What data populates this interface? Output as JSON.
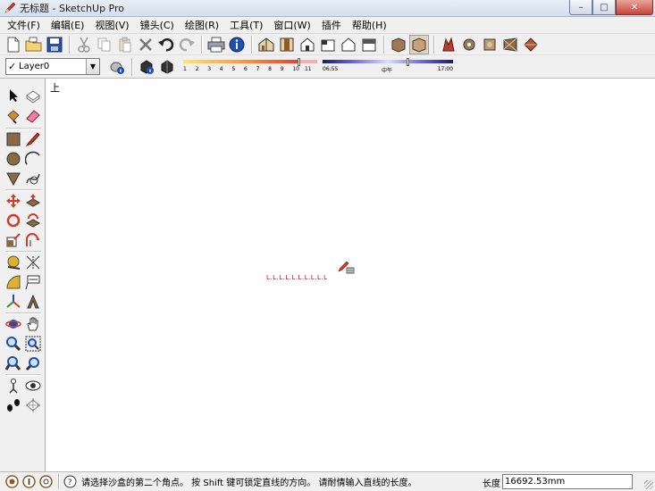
{
  "window": {
    "title": "无标题 - SketchUp Pro",
    "icon": "sketchup-pencil-icon",
    "controls": {
      "minimize": "–",
      "maximize": "□",
      "close": "✕"
    }
  },
  "menu": [
    "文件(F)",
    "编辑(E)",
    "视图(V)",
    "镜头(C)",
    "绘图(R)",
    "工具(T)",
    "窗口(W)",
    "插件",
    "帮助(H)"
  ],
  "toolbar_standard": [
    "new-icon",
    "open-icon",
    "save-icon",
    "cut-icon",
    "copy-icon",
    "paste-icon",
    "erase-icon",
    "undo-icon",
    "redo-icon",
    "print-icon",
    "model-info-icon"
  ],
  "toolbar_views": [
    "iso-view-icon",
    "top-view-icon",
    "front-view-icon",
    "right-view-icon",
    "back-view-icon",
    "left-view-icon"
  ],
  "toolbar_styles": [
    "xray-icon",
    "wireframe-icon",
    "hidden-line-icon",
    "shaded-icon",
    "shaded-texture-icon",
    "monochrome-icon"
  ],
  "layers": {
    "current": "Layer0",
    "checked": "✓"
  },
  "shadows": {
    "months": [
      "1",
      "2",
      "3",
      "4",
      "5",
      "6",
      "7",
      "8",
      "9",
      "10",
      "11"
    ],
    "time_start": "06:55",
    "time_mid": "中午",
    "time_end": "17:00"
  },
  "left_tools": [
    "select-icon",
    "make-component-icon",
    "paint-bucket-icon",
    "eraser-icon",
    "rectangle-icon",
    "line-icon",
    "circle-icon",
    "arc-icon",
    "polygon-icon",
    "freehand-icon",
    "move-icon",
    "push-pull-icon",
    "rotate-icon",
    "follow-me-icon",
    "scale-icon",
    "offset-icon",
    "tape-measure-icon",
    "dimension-icon",
    "protractor-icon",
    "text-icon",
    "axes-icon",
    "3d-text-icon",
    "orbit-icon",
    "pan-icon",
    "zoom-icon",
    "zoom-window-icon",
    "zoom-previous-icon",
    "zoom-extents-icon",
    "position-camera-icon",
    "look-around-icon",
    "walk-icon",
    "section-plane-icon"
  ],
  "canvas": {
    "view_name": "上",
    "dimension_text": "L.L.L.L.L.L.L.L.L.L"
  },
  "status": {
    "message": "请选择沙盒的第二个角点。 按 Shift 键可锁定直线的方向。 请耐情输入直线的长度。",
    "vcb_label": "长度",
    "vcb_value": "16692.53mm"
  },
  "colors": {
    "chrome": "#f0f0f0",
    "titlebar": "#dbe4f0",
    "canvas": "#ffffff",
    "dimension": "#d00000"
  }
}
